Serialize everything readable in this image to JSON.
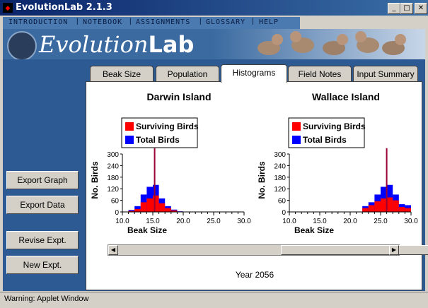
{
  "window": {
    "title": "EvolutionLab 2.1.3",
    "minimize": "_",
    "maximize": "□",
    "close": "✕"
  },
  "menu": [
    "INTRODUCTION",
    "NOTEBOOK",
    "ASSIGNMENTS",
    "GLOSSARY",
    "HELP"
  ],
  "banner": {
    "logo_plain": "Evolution",
    "logo_bold": "Lab"
  },
  "sidebar": {
    "export_graph": "Export Graph",
    "export_data": "Export Data",
    "revise": "Revise Expt.",
    "new": "New Expt."
  },
  "tabs": [
    "Beak Size",
    "Population",
    "Histograms",
    "Field Notes",
    "Input Summary"
  ],
  "active_tab": "Histograms",
  "year_label": "Year 2056",
  "status": "Warning: Applet Window",
  "colors": {
    "surviving": "#ff0000",
    "total": "#0000ff",
    "mean_line": "#990033"
  },
  "chart_data": [
    {
      "type": "bar",
      "title": "Darwin Island",
      "xlabel": "Beak Size",
      "ylabel": "No. Birds",
      "xlim": [
        10.0,
        30.0
      ],
      "ylim": [
        0,
        300
      ],
      "xticks": [
        "10.0",
        "15.0",
        "20.0",
        "25.0",
        "30.0"
      ],
      "yticks": [
        "0",
        "60",
        "120",
        "180",
        "240",
        "300"
      ],
      "legend": [
        "Surviving Birds",
        "Total Birds"
      ],
      "bin_width": 1,
      "bin_starts": [
        11,
        12,
        13,
        14,
        15,
        16,
        17,
        18,
        19
      ],
      "series": [
        {
          "name": "Total Birds",
          "values": [
            10,
            30,
            90,
            130,
            140,
            70,
            30,
            12,
            3
          ]
        },
        {
          "name": "Surviving Birds",
          "values": [
            5,
            15,
            50,
            70,
            85,
            45,
            20,
            8,
            2
          ]
        }
      ],
      "mean_line": 15.3,
      "mean_line_top": 330
    },
    {
      "type": "bar",
      "title": "Wallace Island",
      "xlabel": "Beak Size",
      "ylabel": "No. Birds",
      "xlim": [
        10.0,
        30.0
      ],
      "ylim": [
        0,
        300
      ],
      "xticks": [
        "10.0",
        "15.0",
        "20.0",
        "25.0",
        "30.0"
      ],
      "yticks": [
        "0",
        "60",
        "120",
        "180",
        "240",
        "300"
      ],
      "legend": [
        "Surviving Birds",
        "Total Birds"
      ],
      "bin_width": 1,
      "bin_starts": [
        22,
        23,
        24,
        25,
        26,
        27,
        28,
        29
      ],
      "series": [
        {
          "name": "Total Birds",
          "values": [
            30,
            50,
            90,
            130,
            140,
            90,
            40,
            35
          ]
        },
        {
          "name": "Surviving Birds",
          "values": [
            20,
            35,
            55,
            70,
            75,
            60,
            25,
            20
          ]
        }
      ],
      "mean_line": 26.0,
      "mean_line_top": 330
    }
  ]
}
